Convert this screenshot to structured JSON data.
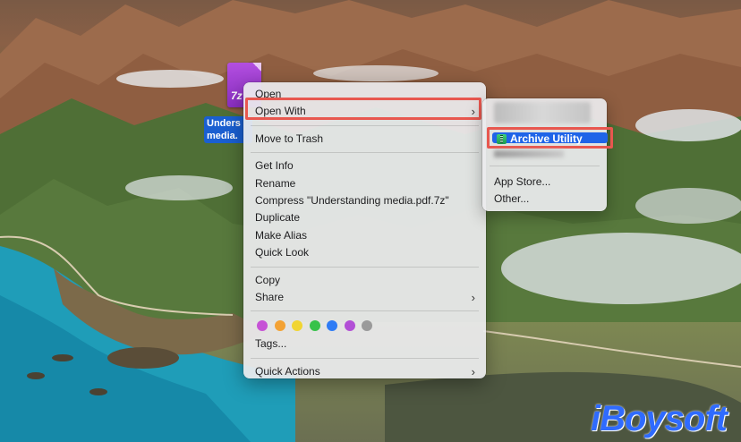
{
  "desktop": {
    "file": {
      "icon_text": "7z",
      "label_line1": "Unders",
      "label_line2": "media."
    }
  },
  "context_menu": {
    "items": [
      {
        "label": "Open"
      },
      {
        "label": "Open With",
        "chevron": "›"
      },
      {
        "label": "Move to Trash"
      },
      {
        "label": "Get Info"
      },
      {
        "label": "Rename"
      },
      {
        "label": "Compress \"Understanding media.pdf.7z\""
      },
      {
        "label": "Duplicate"
      },
      {
        "label": "Make Alias"
      },
      {
        "label": "Quick Look"
      },
      {
        "label": "Copy"
      },
      {
        "label": "Share",
        "chevron": "›"
      },
      {
        "label": "Tags..."
      },
      {
        "label": "Quick Actions",
        "chevron": "›"
      }
    ],
    "tag_colors": [
      "#c653d6",
      "#f3a234",
      "#f1d532",
      "#37c24a",
      "#2f7cf5",
      "#b24fd6",
      "#9a9a9a"
    ],
    "highlight_color": "#e8574f"
  },
  "submenu": {
    "selected": "Archive Utility",
    "selected_icon": "archive-utility-icon",
    "items": [
      {
        "label": "App Store..."
      },
      {
        "label": "Other..."
      }
    ],
    "selected_color": "#1f64e8"
  },
  "watermark": {
    "text": "iBoysoft"
  }
}
